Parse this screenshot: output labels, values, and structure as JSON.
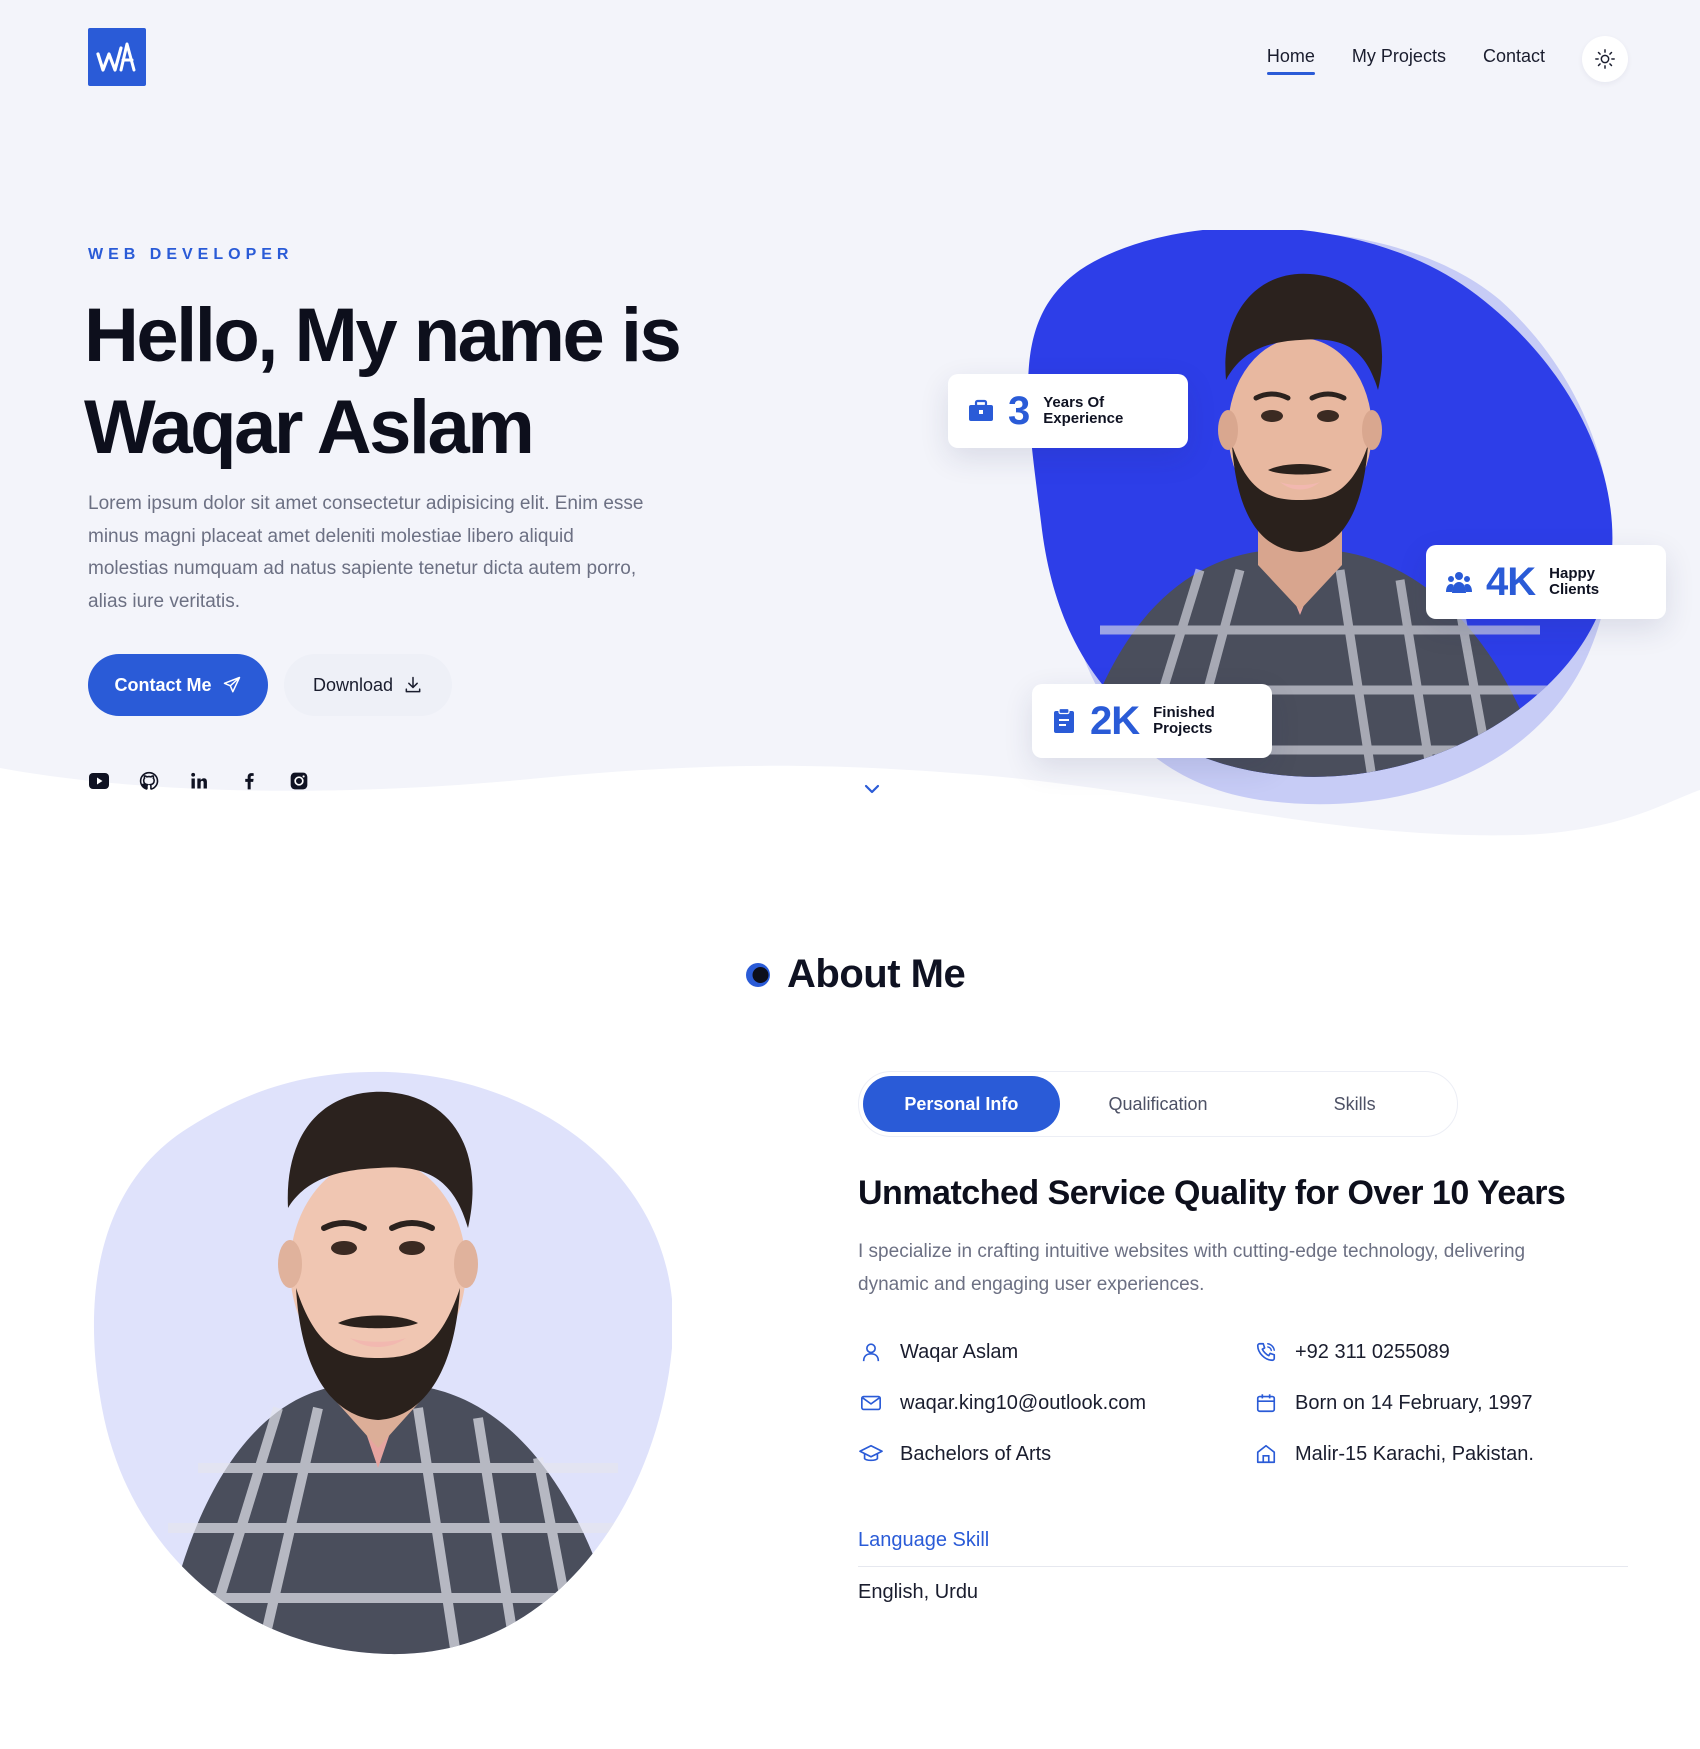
{
  "nav": {
    "items": [
      {
        "label": "Home",
        "active": true
      },
      {
        "label": "My Projects",
        "active": false
      },
      {
        "label": "Contact",
        "active": false
      }
    ],
    "theme_toggle_icon": "sun-icon"
  },
  "hero": {
    "eyebrow": "WEB DEVELOPER",
    "title_line1": "Hello, My name is",
    "title_line2": "Waqar Aslam",
    "description": "Lorem ipsum dolor sit amet consectetur adipisicing elit. Enim esse minus magni placeat amet deleniti molestiae libero aliquid molestias numquam ad natus sapiente tenetur dicta autem porro, alias iure veritatis.",
    "contact_button": "Contact Me",
    "download_button": "Download",
    "socials": [
      "youtube-icon",
      "github-icon",
      "linkedin-icon",
      "facebook-icon",
      "instagram-icon"
    ]
  },
  "stats": [
    {
      "number": "3",
      "label_line1": "Years Of",
      "label_line2": "Experience",
      "icon": "briefcase-icon"
    },
    {
      "number": "4K",
      "label_line1": "Happy",
      "label_line2": "Clients",
      "icon": "users-icon"
    },
    {
      "number": "2K",
      "label_line1": "Finished",
      "label_line2": "Projects",
      "icon": "clipboard-icon"
    }
  ],
  "about": {
    "title": "About Me",
    "tabs": [
      {
        "label": "Personal Info",
        "active": true
      },
      {
        "label": "Qualification",
        "active": false
      },
      {
        "label": "Skills",
        "active": false
      }
    ],
    "heading": "Unmatched Service Quality for Over 10 Years",
    "description": "I specialize in crafting intuitive websites with cutting-edge technology, delivering dynamic and engaging user experiences.",
    "info": {
      "name": "Waqar Aslam",
      "phone": "+92 311 0255089",
      "email": "waqar.king10@outlook.com",
      "birth": "Born on 14 February, 1997",
      "education": "Bachelors of Arts",
      "address": "Malir-15 Karachi, Pakistan."
    },
    "language_label": "Language Skill",
    "languages": "English, Urdu"
  },
  "colors": {
    "accent": "#2a5bd7",
    "blob": "#2d3ee8",
    "blob_shadow": "#c7ccf6",
    "hero_bg": "#f3f4fa",
    "about_blob": "#dfe2fb"
  }
}
